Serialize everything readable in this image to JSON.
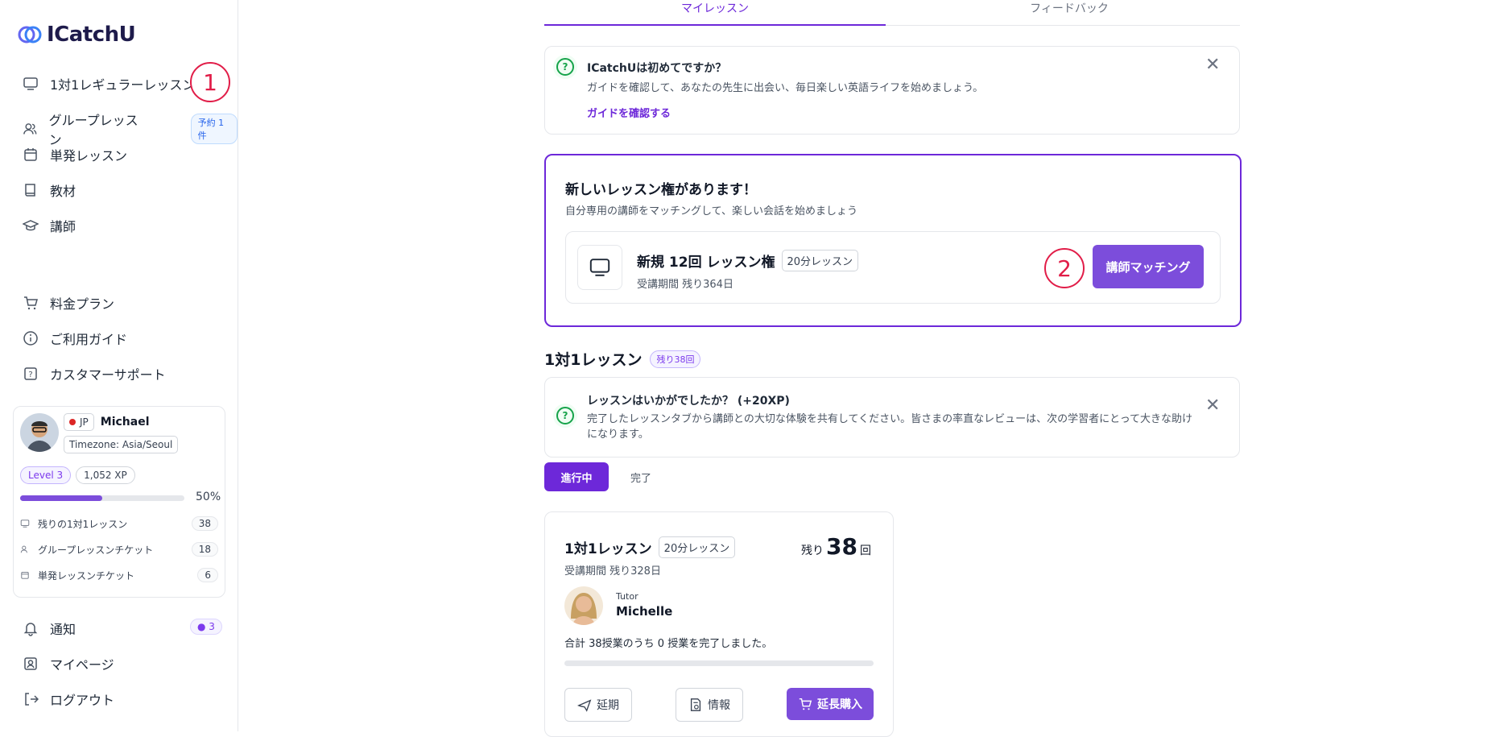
{
  "app": {
    "name": "ICatchU"
  },
  "sidebar": {
    "items": [
      {
        "label": "1対1レギュラーレッスン",
        "icon": "monitor-icon"
      },
      {
        "label": "グループレッスン",
        "icon": "users-icon",
        "badge": "予約 1件"
      },
      {
        "label": "単発レッスン",
        "icon": "calendar-icon"
      },
      {
        "label": "教材",
        "icon": "book-icon"
      },
      {
        "label": "講師",
        "icon": "graduation-cap-icon"
      }
    ],
    "secondary": [
      {
        "label": "料金プラン",
        "icon": "cart-icon"
      },
      {
        "label": "ご利用ガイド",
        "icon": "info-icon"
      },
      {
        "label": "カスタマーサポート",
        "icon": "help-icon"
      }
    ],
    "bottom": [
      {
        "label": "通知",
        "icon": "bell-icon",
        "badge": "3"
      },
      {
        "label": "マイページ",
        "icon": "user-square-icon"
      },
      {
        "label": "ログアウト",
        "icon": "logout-icon"
      }
    ]
  },
  "profile": {
    "country": "JP",
    "name": "Michael",
    "timezone": "Timezone: Asia/Seoul",
    "level": "Level 3",
    "xp": "1,052 XP",
    "progress_percent": 50,
    "progress_label": "50%",
    "tickets": [
      {
        "label": "残りの1対1レッスン",
        "count": "38"
      },
      {
        "label": "グループレッスンチケット",
        "count": "18"
      },
      {
        "label": "単発レッスンチケット",
        "count": "6"
      }
    ]
  },
  "annotations": {
    "one": "1",
    "two": "2"
  },
  "tabs": [
    {
      "label": "マイレッスン",
      "active": true
    },
    {
      "label": "フィードバック",
      "active": false
    }
  ],
  "welcome": {
    "title": "ICatchUは初めてですか？",
    "body": "ガイドを確認して、あなたの先生に出会い、毎日楽しい英語ライフを始めましょう。",
    "link": "ガイドを確認する"
  },
  "new_lesson": {
    "title": "新しいレッスン権があります！",
    "subtitle": "自分専用の講師をマッチングして、楽しい会話を始めましょう",
    "pack_title": "新規 12回 レッスン権",
    "pack_tag": "20分レッスン",
    "pack_period": "受講期間 残り364日",
    "button": "講師マッチング"
  },
  "one_on_one": {
    "heading": "1対1レッスン",
    "badge": "残り38回",
    "review_title": "レッスンはいかがでしたか？ (+20XP)",
    "review_body": "完了したレッスンタブから講師との大切な体験を共有してください。皆さまの率直なレビューは、次の学習者にとって大きな助けになります。"
  },
  "filters": [
    {
      "label": "進行中",
      "active": true
    },
    {
      "label": "完了",
      "active": false
    }
  ],
  "lesson_card": {
    "title": "1対1レッスン",
    "tag": "20分レッスン",
    "remaining_prefix": "残り",
    "remaining_count": "38",
    "remaining_suffix": "回",
    "period": "受講期間 残り328日",
    "tutor_label": "Tutor",
    "tutor_name": "Michelle",
    "summary": "合計 38授業のうち 0 授業を完了しました。",
    "progress_percent": 0,
    "buttons": {
      "postpone": "延期",
      "info": "情報",
      "extend": "延長購入"
    }
  },
  "colors": {
    "accent": "#7c4ddb",
    "annotation": "#e11d48",
    "success": "#16a34a"
  }
}
